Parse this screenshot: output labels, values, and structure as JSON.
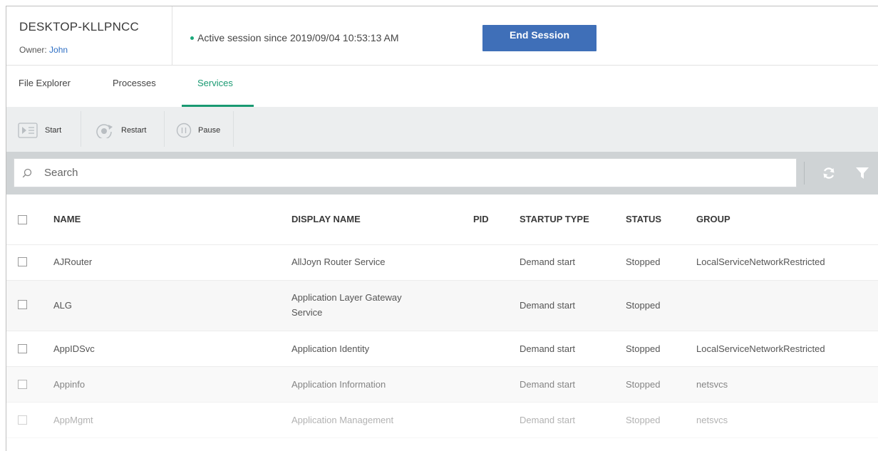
{
  "header": {
    "device_name": "DESKTOP-KLLPNCC",
    "owner_label": "Owner:",
    "owner_name": "John",
    "session_text": "Active session since 2019/09/04 10:53:13 AM",
    "end_session_label": "End Session"
  },
  "tabs": [
    {
      "label": "File Explorer",
      "active": false
    },
    {
      "label": "Processes",
      "active": false
    },
    {
      "label": "Services",
      "active": true
    }
  ],
  "toolbar": {
    "start_label": "Start",
    "restart_label": "Restart",
    "pause_label": "Pause"
  },
  "search": {
    "placeholder": "Search"
  },
  "table": {
    "columns": [
      "NAME",
      "DISPLAY NAME",
      "PID",
      "STARTUP TYPE",
      "STATUS",
      "GROUP"
    ],
    "rows": [
      {
        "name": "AJRouter",
        "display_name": "AllJoyn Router Service",
        "display_name_line2": "",
        "pid": "",
        "startup_type": "Demand start",
        "status": "Stopped",
        "group": "LocalServiceNetworkRestricted"
      },
      {
        "name": "ALG",
        "display_name": "Application Layer Gateway",
        "display_name_line2": "Service",
        "pid": "",
        "startup_type": "Demand start",
        "status": "Stopped",
        "group": ""
      },
      {
        "name": "AppIDSvc",
        "display_name": "Application Identity",
        "display_name_line2": "",
        "pid": "",
        "startup_type": "Demand start",
        "status": "Stopped",
        "group": "LocalServiceNetworkRestricted"
      },
      {
        "name": "Appinfo",
        "display_name": "Application Information",
        "display_name_line2": "",
        "pid": "",
        "startup_type": "Demand start",
        "status": "Stopped",
        "group": "netsvcs"
      },
      {
        "name": "AppMgmt",
        "display_name": "Application Management",
        "display_name_line2": "",
        "pid": "",
        "startup_type": "Demand start",
        "status": "Stopped",
        "group": "netsvcs"
      }
    ]
  },
  "colors": {
    "accent_green": "#1a9a72",
    "button_blue": "#3f6fb8",
    "link_blue": "#2e6fc4"
  }
}
